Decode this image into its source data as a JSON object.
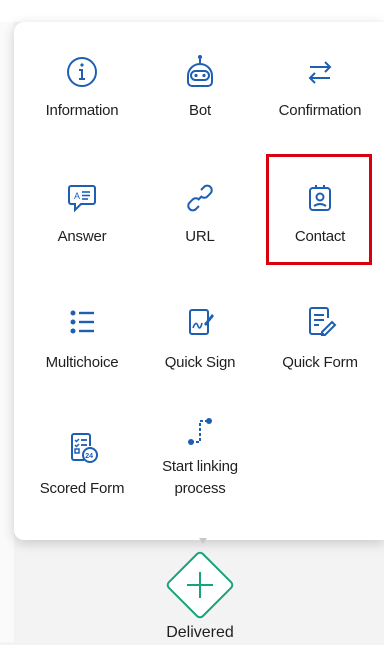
{
  "menu": {
    "items": [
      {
        "label": "Information",
        "icon": "info-icon"
      },
      {
        "label": "Bot",
        "icon": "bot-icon"
      },
      {
        "label": "Confirmation",
        "icon": "swap-arrows-icon"
      },
      {
        "label": "Answer",
        "icon": "answer-bubble-icon"
      },
      {
        "label": "URL",
        "icon": "link-icon"
      },
      {
        "label": "Contact",
        "icon": "contact-icon"
      },
      {
        "label": "Multichoice",
        "icon": "list-icon"
      },
      {
        "label": "Quick Sign",
        "icon": "sign-icon"
      },
      {
        "label": "Quick Form",
        "icon": "form-edit-icon"
      },
      {
        "label": "Scored Form",
        "icon": "scored-form-icon"
      },
      {
        "label": "Start linking process",
        "icon": "linking-process-icon"
      }
    ],
    "highlighted_item": "Contact"
  },
  "flow": {
    "node_label": "Delivered",
    "add_icon": "plus-icon"
  },
  "colors": {
    "icon_blue": "#1e5fb4",
    "node_green": "#19a37a",
    "highlight_red": "#d8000c"
  }
}
